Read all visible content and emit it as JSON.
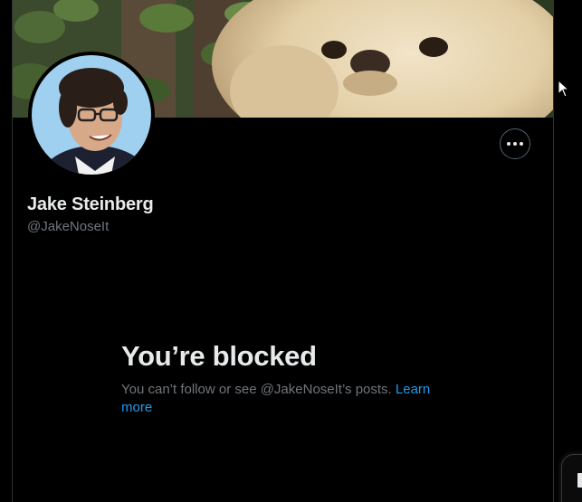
{
  "profile": {
    "display_name": "Jake Steinberg",
    "handle": "@JakeNoseIt"
  },
  "blocked": {
    "title": "You’re blocked",
    "description": "You can’t follow or see @JakeNoseIt’s posts. ",
    "learn_more": "Learn more"
  },
  "icons": {
    "more": "more-options-icon",
    "cursor": "mouse-pointer-icon"
  },
  "colors": {
    "background": "#000000",
    "primary_text": "#e7e9ea",
    "secondary_text": "#71767b",
    "link": "#1d9bf0",
    "border": "#2f3336"
  }
}
